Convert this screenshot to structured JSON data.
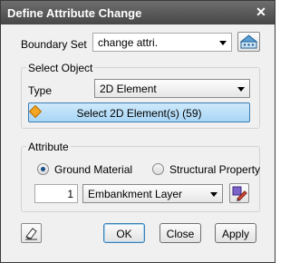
{
  "window": {
    "title": "Define Attribute Change",
    "close_glyph": "✕"
  },
  "boundary_set": {
    "label": "Boundary Set",
    "value": "change attri.",
    "button_icon": "boundary-set-icon"
  },
  "select_object": {
    "group_title": "Select Object",
    "type_label": "Type",
    "type_value": "2D Element",
    "select_button_label": "Select 2D Element(s) (59)"
  },
  "attribute": {
    "group_title": "Attribute",
    "options": [
      {
        "label": "Ground Material",
        "selected": true
      },
      {
        "label": "Structural Property",
        "selected": false
      }
    ],
    "number_value": "1",
    "material_value": "Embankment Layer"
  },
  "footer": {
    "ok_label": "OK",
    "close_label": "Close",
    "apply_label": "Apply"
  },
  "colors": {
    "title_bar": "#474747",
    "select_button": "#a8d6f6",
    "accent": "#3c7fb1"
  }
}
